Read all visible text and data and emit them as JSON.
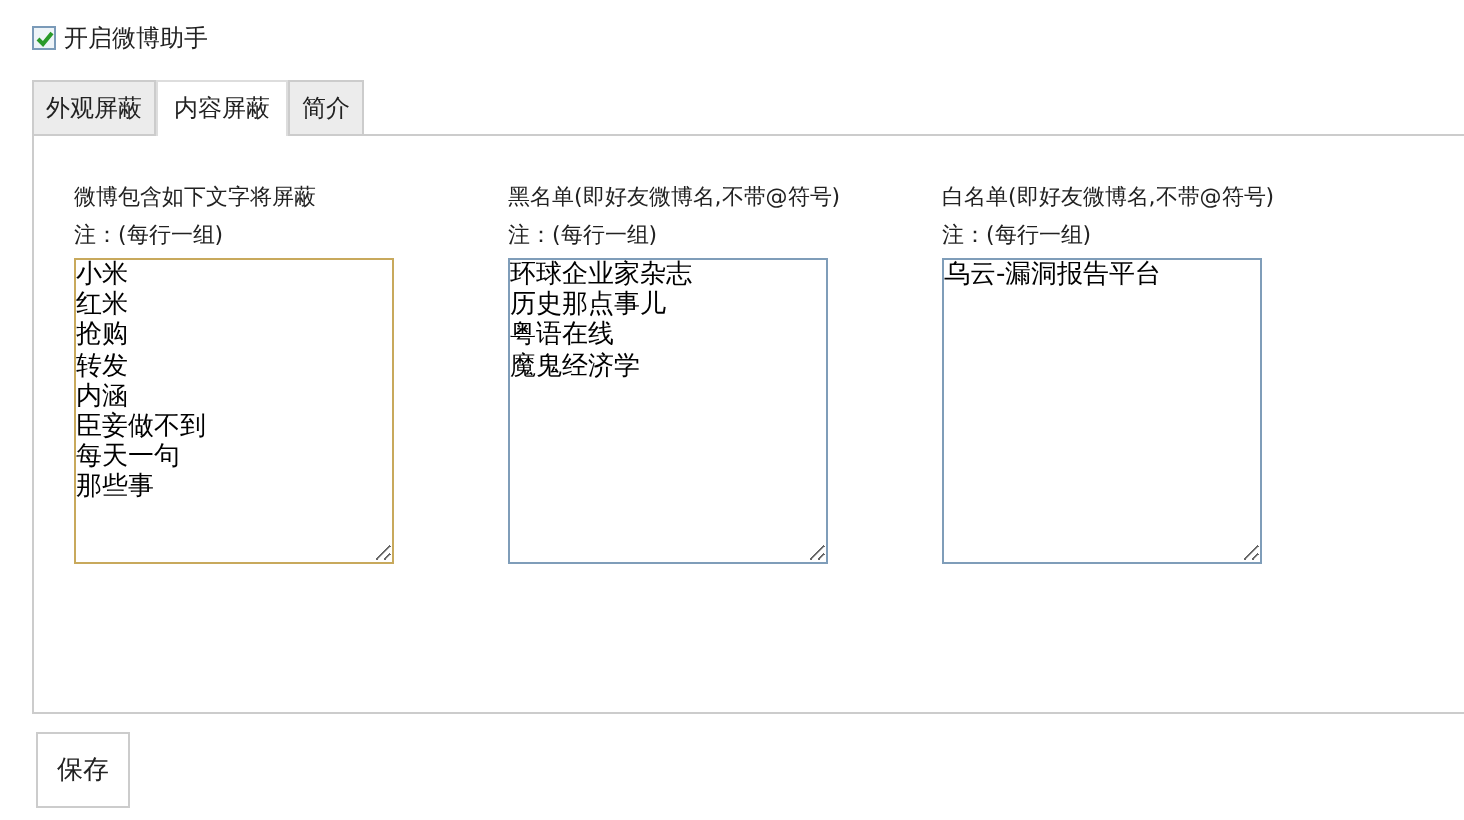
{
  "enable": {
    "label": "开启微博助手",
    "checked": true
  },
  "tabs": [
    {
      "label": "外观屏蔽",
      "selected": false
    },
    {
      "label": "内容屏蔽",
      "selected": true
    },
    {
      "label": "简介",
      "selected": false
    }
  ],
  "columns": [
    {
      "title": "微博包含如下文字将屏蔽",
      "note": "注：(每行一组)",
      "focused": true,
      "lines": [
        "小米",
        "红米",
        "抢购",
        "转发",
        "内涵",
        "臣妾做不到",
        "每天一句",
        "那些事"
      ]
    },
    {
      "title": "黑名单(即好友微博名,不带@符号)",
      "note": "注：(每行一组)",
      "focused": false,
      "lines": [
        "环球企业家杂志",
        "历史那点事儿",
        "粤语在线",
        "魔鬼经济学"
      ]
    },
    {
      "title": "白名单(即好友微博名,不带@符号)",
      "note": "注：(每行一组)",
      "focused": false,
      "lines": [
        "乌云-漏洞报告平台"
      ]
    }
  ],
  "save_button": "保存"
}
